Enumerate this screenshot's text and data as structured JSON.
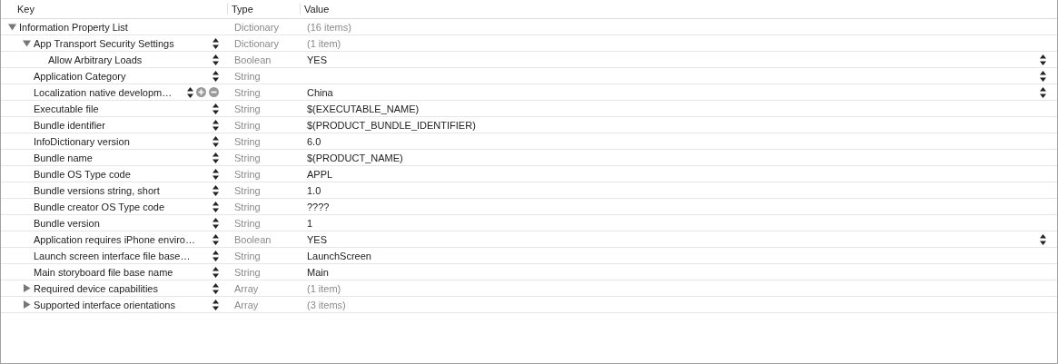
{
  "columns": [
    "Key",
    "Type",
    "Value"
  ],
  "rows": [
    {
      "key": "Information Property List",
      "type": "Dictionary",
      "value": "(16 items)",
      "kind": "container",
      "hovered": false,
      "root": true,
      "expanded": true,
      "children": [
        {
          "key": "App Transport Security Settings",
          "type": "Dictionary",
          "value": "(1 item)",
          "kind": "container",
          "hovered": false,
          "expanded": true,
          "children": [
            {
              "key": "Allow Arbitrary Loads",
              "type": "Boolean",
              "value": "YES",
              "kind": "popup",
              "hovered": false
            }
          ]
        },
        {
          "key": "Application Category",
          "type": "String",
          "kind": "popup",
          "hovered": false
        },
        {
          "key": "Localization native developm…",
          "type": "String",
          "value": "China",
          "kind": "popup",
          "hovered": true
        },
        {
          "key": "Executable file",
          "type": "String",
          "value": "$(EXECUTABLE_NAME)",
          "kind": "text",
          "hovered": false
        },
        {
          "key": "Bundle identifier",
          "type": "String",
          "value": "$(PRODUCT_BUNDLE_IDENTIFIER)",
          "kind": "text",
          "hovered": false
        },
        {
          "key": "InfoDictionary version",
          "type": "String",
          "value": "6.0",
          "kind": "text",
          "hovered": false
        },
        {
          "key": "Bundle name",
          "type": "String",
          "value": "$(PRODUCT_NAME)",
          "kind": "text",
          "hovered": false
        },
        {
          "key": "Bundle OS Type code",
          "type": "String",
          "value": "APPL",
          "kind": "text",
          "hovered": false
        },
        {
          "key": "Bundle versions string, short",
          "type": "String",
          "value": "1.0",
          "kind": "text",
          "hovered": false
        },
        {
          "key": "Bundle creator OS Type code",
          "type": "String",
          "value": "????",
          "kind": "text",
          "hovered": false
        },
        {
          "key": "Bundle version",
          "type": "String",
          "value": "1",
          "kind": "text",
          "hovered": false
        },
        {
          "key": "Application requires iPhone enviro…",
          "type": "Boolean",
          "value": "YES",
          "kind": "popup",
          "hovered": false
        },
        {
          "key": "Launch screen interface file base…",
          "type": "String",
          "value": "LaunchScreen",
          "kind": "text",
          "hovered": false
        },
        {
          "key": "Main storyboard file base name",
          "type": "String",
          "value": "Main",
          "kind": "text",
          "hovered": false
        },
        {
          "key": "Required device capabilities",
          "type": "Array",
          "value": "(1 item)",
          "kind": "container",
          "hovered": false,
          "expanded": false
        },
        {
          "key": "Supported interface orientations",
          "type": "Array",
          "value": "(3 items)",
          "kind": "container",
          "hovered": false,
          "expanded": false
        }
      ]
    }
  ]
}
